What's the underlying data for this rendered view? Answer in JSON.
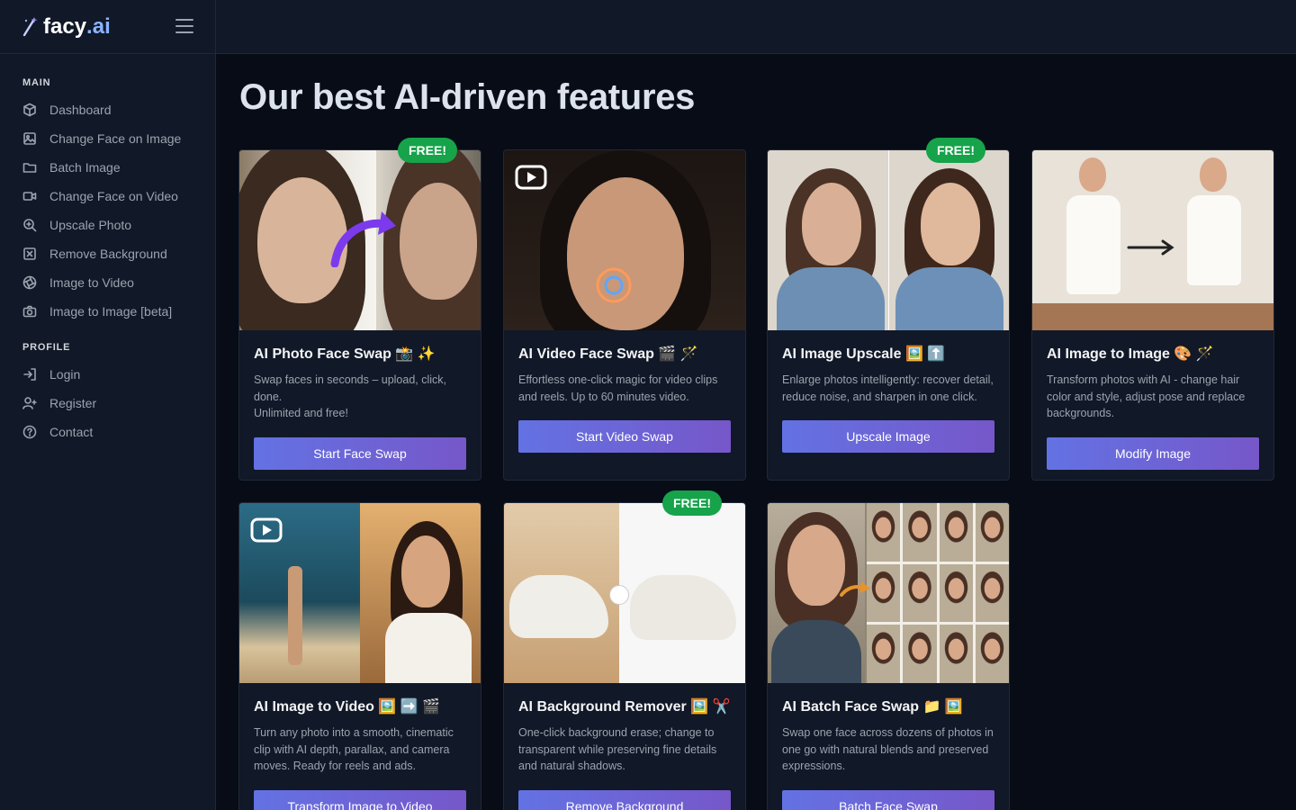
{
  "brand": {
    "name": "facy",
    "tld": ".ai"
  },
  "sidebar": {
    "main_label": "MAIN",
    "main_items": [
      {
        "label": "Dashboard",
        "icon": "cube-icon"
      },
      {
        "label": "Change Face on Image",
        "icon": "image-icon"
      },
      {
        "label": "Batch Image",
        "icon": "folder-icon"
      },
      {
        "label": "Change Face on Video",
        "icon": "video-icon"
      },
      {
        "label": "Upscale Photo",
        "icon": "zoom-in-icon"
      },
      {
        "label": "Remove Background",
        "icon": "remove-box-icon"
      },
      {
        "label": "Image to Video",
        "icon": "aperture-icon"
      },
      {
        "label": "Image to Image [beta]",
        "icon": "camera-icon"
      }
    ],
    "profile_label": "PROFILE",
    "profile_items": [
      {
        "label": "Login",
        "icon": "login-icon"
      },
      {
        "label": "Register",
        "icon": "user-plus-icon"
      },
      {
        "label": "Contact",
        "icon": "help-circle-icon"
      }
    ]
  },
  "main": {
    "title": "Our best AI-driven features",
    "cards": [
      {
        "title": "AI Photo Face Swap 📸 ✨",
        "desc": [
          "Swap faces in seconds – upload, click, done.",
          "Unlimited and free!"
        ],
        "button": "Start Face Swap",
        "badge": "FREE!"
      },
      {
        "title": "AI Video Face Swap 🎬 🪄",
        "desc": [
          "Effortless one-click magic for video clips and reels. Up to 60 minutes video."
        ],
        "button": "Start Video Swap",
        "badge": ""
      },
      {
        "title": "AI Image Upscale 🖼️ ⬆️",
        "desc": [
          "Enlarge photos intelligently: recover detail, reduce noise, and sharpen in one click."
        ],
        "button": "Upscale Image",
        "badge": "FREE!"
      },
      {
        "title": "AI Image to Image 🎨 🪄",
        "desc": [
          "Transform photos with AI - change hair color and style, adjust pose and replace backgrounds."
        ],
        "button": "Modify Image",
        "badge": ""
      },
      {
        "title": "AI Image to Video 🖼️ ➡️ 🎬",
        "desc": [
          "Turn any photo into a smooth, cinematic clip with AI depth, parallax, and camera moves. Ready for reels and ads."
        ],
        "button": "Transform Image to Video",
        "badge": ""
      },
      {
        "title": "AI Background Remover 🖼️ ✂️",
        "desc": [
          "One-click background erase; change to transparent while preserving fine details and natural shadows."
        ],
        "button": "Remove Background",
        "badge": "FREE!"
      },
      {
        "title": "AI Batch Face Swap 📁 🖼️",
        "desc": [
          "Swap one face across dozens of photos in one go with natural blends and preserved expressions."
        ],
        "button": "Batch Face Swap",
        "badge": ""
      }
    ]
  }
}
